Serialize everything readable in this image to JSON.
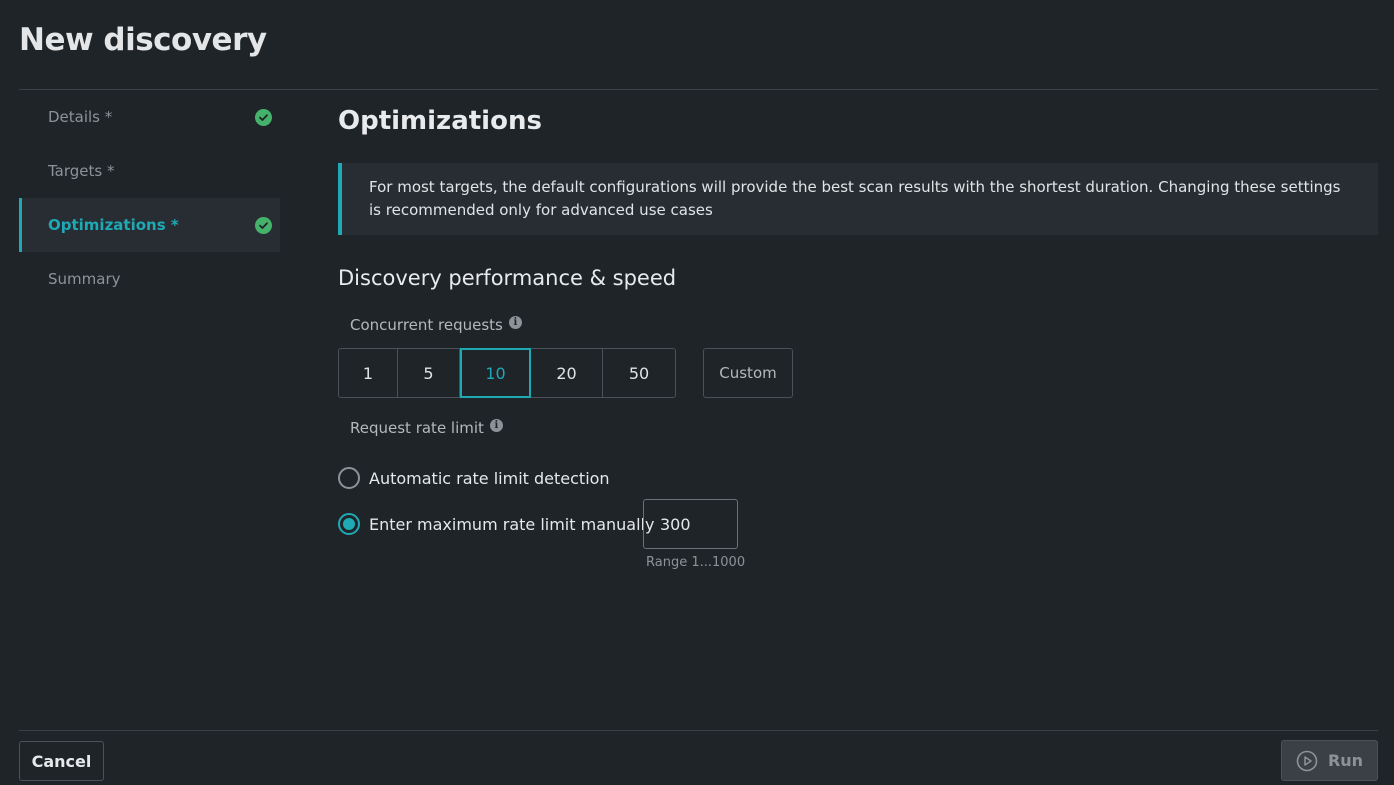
{
  "page": {
    "title": "New discovery"
  },
  "sidebar": {
    "steps": [
      {
        "label": "Details *",
        "completed": true,
        "active": false
      },
      {
        "label": "Targets *",
        "completed": false,
        "active": false
      },
      {
        "label": "Optimizations *",
        "completed": true,
        "active": true
      },
      {
        "label": "Summary",
        "completed": false,
        "active": false
      }
    ]
  },
  "main": {
    "section_title": "Optimizations",
    "info_text": "For most targets, the default configurations will provide the best scan results with the shortest duration. Changing these settings is recommended only for advanced use cases",
    "subsection_title": "Discovery performance & speed",
    "concurrent": {
      "label": "Concurrent requests",
      "options": [
        "1",
        "5",
        "10",
        "20",
        "50"
      ],
      "selected": "10",
      "custom_label": "Custom"
    },
    "rate_limit": {
      "label": "Request rate limit",
      "option_auto": "Automatic rate limit detection",
      "option_manual": "Enter maximum rate limit manually",
      "selected": "manual",
      "value": "300",
      "range_hint": "Range 1...1000"
    }
  },
  "footer": {
    "cancel_label": "Cancel",
    "run_label": "Run"
  },
  "colors": {
    "accent": "#1ea9b5",
    "success": "#45b26b",
    "background": "#1f2428"
  }
}
